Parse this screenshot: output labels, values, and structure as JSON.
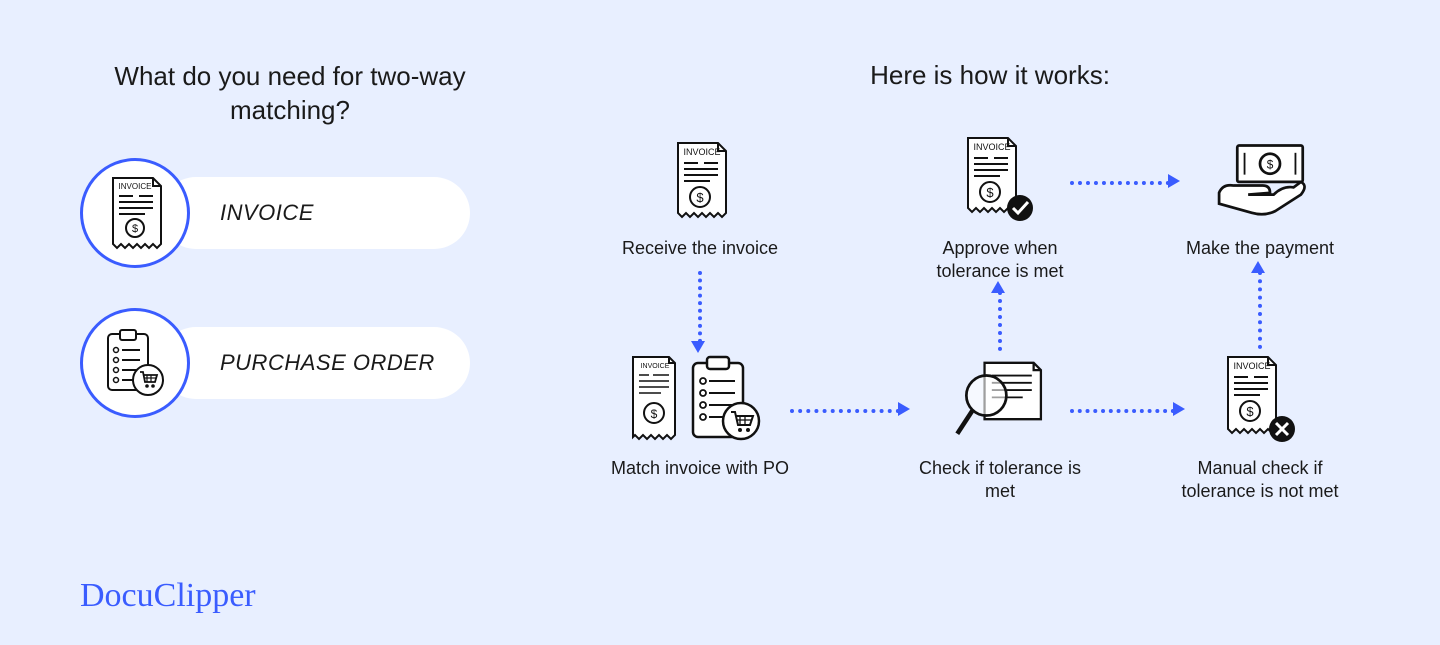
{
  "left": {
    "heading": "What do you need for two-way matching?",
    "items": [
      {
        "label": "INVOICE"
      },
      {
        "label": "PURCHASE ORDER"
      }
    ]
  },
  "right": {
    "heading": "Here is how it works:",
    "nodes": {
      "receive": "Receive the invoice",
      "approve": "Approve when tolerance is met",
      "pay": "Make the payment",
      "match": "Match invoice with PO",
      "check": "Check if tolerance is met",
      "manual": "Manual check if tolerance is not met"
    }
  },
  "logo": "DocuClipper",
  "colors": {
    "accent": "#3a5cff",
    "bg": "#e8efff"
  }
}
